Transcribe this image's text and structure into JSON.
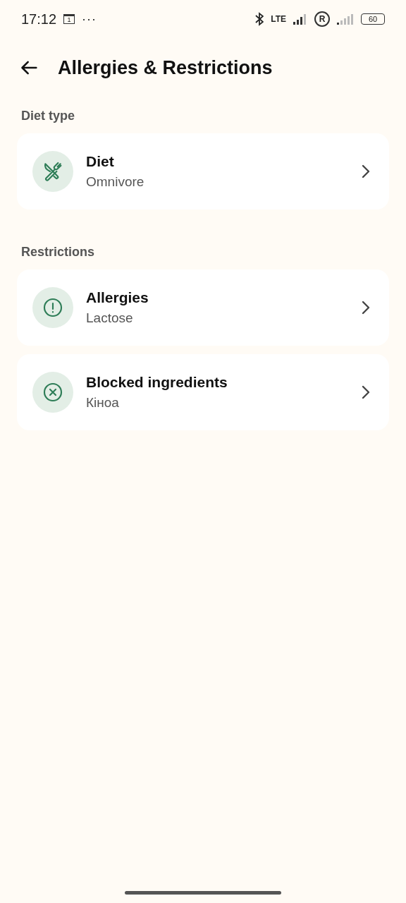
{
  "status_bar": {
    "time": "17:12",
    "calendar_day": "1",
    "more": "···",
    "network": "LTE",
    "roaming": "R",
    "battery": "60"
  },
  "header": {
    "title": "Allergies & Restrictions"
  },
  "sections": [
    {
      "title": "Diet type",
      "items": [
        {
          "kind": "diet",
          "title": "Diet",
          "value": "Omnivore"
        }
      ]
    },
    {
      "title": "Restrictions",
      "items": [
        {
          "kind": "allergy",
          "title": "Allergies",
          "value": "Lactose"
        },
        {
          "kind": "blocked",
          "title": "Blocked ingredients",
          "value": "Кіноа"
        }
      ]
    }
  ]
}
